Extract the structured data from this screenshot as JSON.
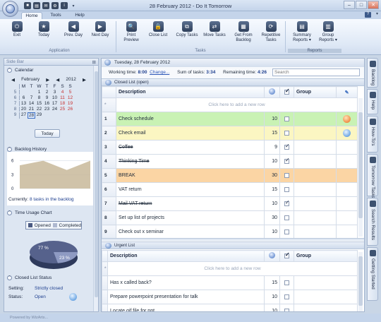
{
  "app": {
    "title": "28 February 2012 - Do It Tomorrow"
  },
  "tabs": [
    "Home",
    "Tools",
    "Help"
  ],
  "ribbon": {
    "buttons": {
      "exit": "Exit",
      "today": "Today",
      "prev_day": "Prev. Day",
      "next_day": "Next Day",
      "print_preview": "Print\nPreview",
      "close_list": "Close List",
      "copy_tasks": "Copy Tasks",
      "move_tasks": "Move Tasks",
      "get_from_backlog": "Get From\nBacklog",
      "repetitive_tasks": "Repetitive\nTasks",
      "summary_reports": "Summary\nReports ▾",
      "group_reports": "Group\nReports ▾"
    },
    "groups": {
      "application": "Application",
      "tasks": "Tasks",
      "reports": "Reports"
    }
  },
  "sidebar": {
    "title": "Side Bar",
    "calendar": {
      "section": "Calendar",
      "month": "February",
      "year": "2012",
      "dow": [
        "M",
        "T",
        "W",
        "T",
        "F",
        "S",
        "S"
      ],
      "weeks": [
        {
          "wk": "5",
          "days": [
            "",
            "",
            "1",
            "2",
            "3",
            "4",
            "5"
          ]
        },
        {
          "wk": "6",
          "days": [
            "6",
            "7",
            "8",
            "9",
            "10",
            "11",
            "12"
          ]
        },
        {
          "wk": "7",
          "days": [
            "13",
            "14",
            "15",
            "16",
            "17",
            "18",
            "19"
          ]
        },
        {
          "wk": "8",
          "days": [
            "20",
            "21",
            "22",
            "23",
            "24",
            "25",
            "26"
          ]
        },
        {
          "wk": "9",
          "days": [
            "27",
            "28",
            "29",
            "",
            "",
            "",
            ""
          ]
        }
      ],
      "today_button": "Today"
    },
    "backlog": {
      "section": "Backlog History",
      "y_ticks": [
        "6",
        "3",
        "0"
      ],
      "currently_label": "Currently:",
      "currently_value": "8 tasks in the backlog"
    },
    "time_usage": {
      "section": "Time Usage Chart",
      "legend_opened": "Opened",
      "legend_completed": "Completed",
      "opened_pct": "77 %",
      "completed_pct": "23 %"
    },
    "closed_status": {
      "section": "Closed List Status",
      "setting_label": "Setting:",
      "setting_value": "Strictly closed",
      "status_label": "Status:",
      "status_value": "Open"
    }
  },
  "chart_data": {
    "type": "area",
    "x": [
      0,
      1,
      2,
      3
    ],
    "values": [
      5,
      6,
      4,
      6
    ],
    "ylim": [
      0,
      7
    ],
    "yticks": [
      0,
      3,
      6
    ],
    "grid": true
  },
  "main": {
    "date": "Tuesday, 28 February 2012",
    "working_time_label": "Working time:",
    "working_time": "8:00",
    "change_link": "Change...",
    "sum_label": "Sum of tasks:",
    "sum_value": "3:34",
    "remaining_label": "Remaining time:",
    "remaining_value": "4:26",
    "search_placeholder": "Search",
    "closed_list": {
      "title": "Closed List (open)",
      "col_description": "Description",
      "col_group": "Group",
      "add_row": "Click here to add a new row",
      "rows": [
        {
          "n": "1",
          "desc": "Check schedule",
          "time": "10",
          "done": false,
          "color": "green",
          "strike": false,
          "badge": "orange"
        },
        {
          "n": "2",
          "desc": "Check email",
          "time": "15",
          "done": false,
          "color": "yellow",
          "strike": false,
          "badge": "blue"
        },
        {
          "n": "3",
          "desc": "Coffee",
          "time": "9",
          "done": true,
          "color": "",
          "strike": true,
          "badge": ""
        },
        {
          "n": "4",
          "desc": "Thinking Time",
          "time": "10",
          "done": true,
          "color": "",
          "strike": true,
          "badge": ""
        },
        {
          "n": "5",
          "desc": "BREAK",
          "time": "30",
          "done": false,
          "color": "orange",
          "strike": false,
          "badge": ""
        },
        {
          "n": "6",
          "desc": "VAT return",
          "time": "15",
          "done": false,
          "color": "",
          "strike": false,
          "badge": ""
        },
        {
          "n": "7",
          "desc": "Mail VAT return",
          "time": "10",
          "done": true,
          "color": "",
          "strike": true,
          "badge": ""
        },
        {
          "n": "8",
          "desc": "Set up list of projects",
          "time": "30",
          "done": false,
          "color": "",
          "strike": false,
          "badge": ""
        },
        {
          "n": "9",
          "desc": "Check out x seminar",
          "time": "10",
          "done": false,
          "color": "",
          "strike": false,
          "badge": ""
        }
      ]
    },
    "urgent_list": {
      "title": "Urgent List",
      "col_description": "Description",
      "col_group": "Group",
      "add_row": "Click here to add a new row",
      "rows": [
        {
          "desc": "Has x called back?",
          "time": "15",
          "done": false
        },
        {
          "desc": "Prepare powerpoint presentation for talk",
          "time": "10",
          "done": false
        },
        {
          "desc": "Locate gif file for ppt",
          "time": "10",
          "done": false
        }
      ]
    }
  },
  "right_dock": [
    "Backlog",
    "Help",
    "How-To's",
    "Tomorrow Tasks",
    "Search Results",
    "Getting Started"
  ],
  "status_bar": "Powered by WizArts..."
}
